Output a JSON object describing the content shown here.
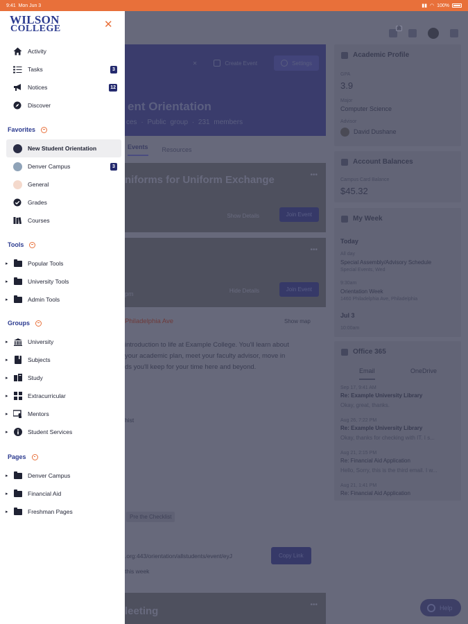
{
  "status": {
    "time": "9:41",
    "date": "Mon Jun 3",
    "battery": "100%"
  },
  "drawer": {
    "logo_line1": "WILSON",
    "logo_line2": "COLLEGE",
    "nav": [
      {
        "label": "Activity",
        "icon": "home-icon"
      },
      {
        "label": "Tasks",
        "icon": "tasks-icon",
        "badge": "3"
      },
      {
        "label": "Notices",
        "icon": "megaphone-icon",
        "badge": "12"
      },
      {
        "label": "Discover",
        "icon": "compass-icon"
      }
    ],
    "favorites_title": "Favorites",
    "favorites": [
      {
        "label": "New Student Orientation",
        "icon": "orientation-avatar-icon",
        "selected": true
      },
      {
        "label": "Denver Campus",
        "icon": "campus-avatar-icon",
        "badge": "3"
      },
      {
        "label": "General",
        "icon": "group-avatar-icon"
      },
      {
        "label": "Grades",
        "icon": "check-badge-icon"
      },
      {
        "label": "Courses",
        "icon": "books-icon"
      }
    ],
    "tools_title": "Tools",
    "tools": [
      {
        "label": "Popular Tools"
      },
      {
        "label": "University Tools"
      },
      {
        "label": "Admin Tools"
      }
    ],
    "groups_title": "Groups",
    "groups": [
      {
        "label": "University",
        "icon": "university-icon"
      },
      {
        "label": "Subjects",
        "icon": "book-icon"
      },
      {
        "label": "Study",
        "icon": "study-icon"
      },
      {
        "label": "Extracurricular",
        "icon": "grid-icon"
      },
      {
        "label": "Mentors",
        "icon": "mentors-icon"
      },
      {
        "label": "Student Services",
        "icon": "info-icon"
      }
    ],
    "pages_title": "Pages",
    "pages": [
      {
        "label": "Denver Campus"
      },
      {
        "label": "Financial Aid"
      },
      {
        "label": "Freshman Pages"
      }
    ]
  },
  "background": {
    "hero": {
      "title": "ent Orientation",
      "subtitle": "ces · Public group · 231 members",
      "create_event": "Create Event",
      "settings": "Settings"
    },
    "tabs": [
      "Events",
      "Resources"
    ],
    "card1": {
      "title": "niforms for Uniform Exchange",
      "show_details": "Show Details",
      "join": "Join Event"
    },
    "card2": {
      "time": "pm",
      "hide_details": "Hide Details",
      "join": "Join Event"
    },
    "location": "Philadelphia Ave",
    "show_map": "Show map",
    "desc": [
      "introduction to life at Example College. You'll learn about",
      "your academic plan, meet your faculty advisor, move in",
      "ds you'll keep for your time here and beyond."
    ],
    "misc1": "hist",
    "chip": "Pre the Checklist",
    "link": ".org:443/orientation/allstudents/event/eyJ",
    "copy_link": "Copy Link",
    "misc2": "this week",
    "card3_title": "leeting",
    "academic": {
      "title": "Academic Profile",
      "gpa_label": "GPA",
      "gpa": "3.9",
      "major_label": "Major",
      "major": "Computer Science",
      "advisor_label": "Advisor",
      "advisor": "David Dushane"
    },
    "balances": {
      "title": "Account Balances",
      "label": "Campus Card Balance",
      "amount": "$45.32"
    },
    "week": {
      "title": "My Week",
      "today": "Today",
      "e1_when": "All day",
      "e1": "Special Assembly/Advisory Schedule",
      "e1_sub": "Special Events, Wed",
      "e2_when": "9:30am",
      "e2": "Orientation Week",
      "e2_sub": "1460 Philadelphia Ave, Philadelphia",
      "jul": "Jul 3",
      "e3_when": "10:00am"
    },
    "office": {
      "title": "Office 365",
      "tab_email": "Email",
      "tab_drive": "OneDrive",
      "mails": [
        {
          "date": "Sep 17, 9:41 AM",
          "subj": "Re: Example University Library",
          "body": "Okay, great, thanks."
        },
        {
          "date": "Aug 26, 7:22 PM",
          "subj": "Re: Example University Library",
          "body": "Okay, thanks for checking with IT. I s..."
        },
        {
          "date": "Aug 21, 2:15 PM",
          "subj": "Re: Financial Aid Application",
          "body": "Hello, Sorry, this is the third email. I w..."
        },
        {
          "date": "Aug 21, 1:41 PM",
          "subj": "Re: Financial Aid Application",
          "body": ""
        }
      ]
    },
    "help": "Help"
  }
}
